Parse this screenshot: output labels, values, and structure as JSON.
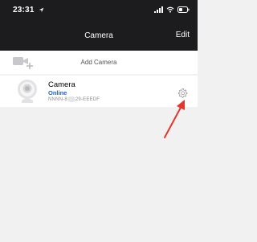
{
  "status_bar": {
    "time": "23:31",
    "location_icon": "location-arrow-icon",
    "signal_icon": "signal-bars-icon",
    "wifi_icon": "wifi-icon",
    "battery_icon": "battery-icon"
  },
  "nav": {
    "title": "Camera",
    "edit_label": "Edit"
  },
  "add_camera": {
    "label": "Add Camera",
    "icon": "add-camera-icon"
  },
  "camera_list": [
    {
      "name": "Camera",
      "status": "Online",
      "uid_prefix": "NNNN-8",
      "uid_suffix": "29-EEEDF",
      "icon": "camera-device-icon",
      "settings_icon": "gear-icon"
    }
  ],
  "colors": {
    "header_bg": "#1c1c1e",
    "page_bg": "#f1f1f2",
    "status_online": "#1f5fd4",
    "annotation_arrow": "#e8352c"
  }
}
